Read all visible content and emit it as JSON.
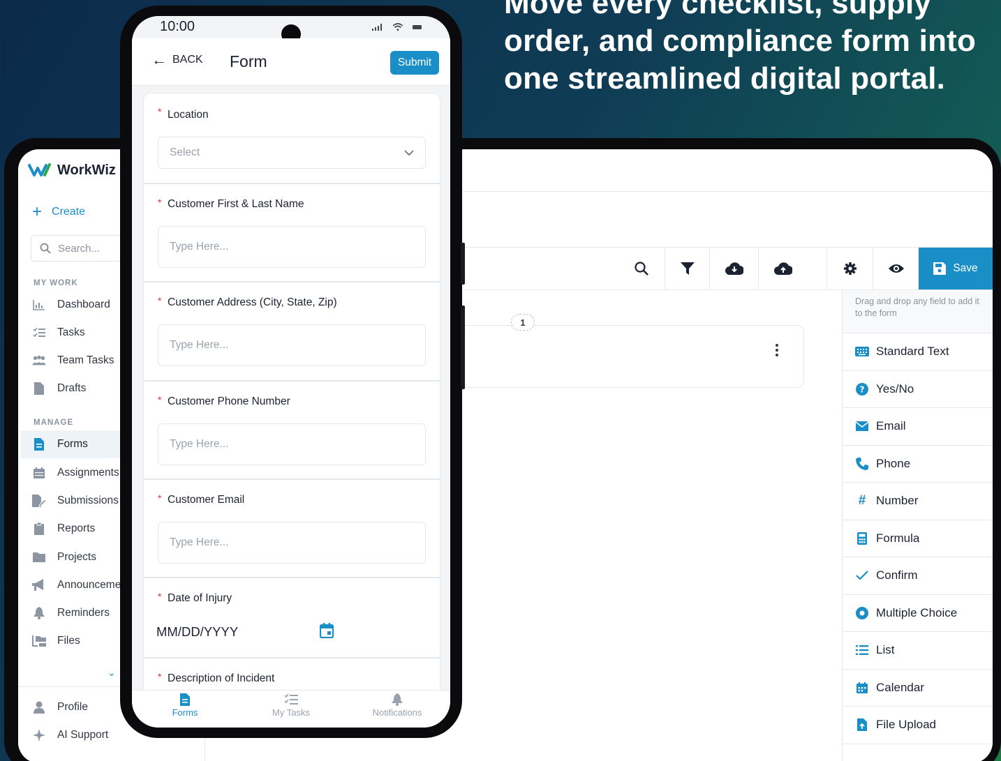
{
  "headline": "Move every checklist, supply order, and compliance form into one streamlined digital portal.",
  "tablet": {
    "logo_text": "WorkWiz",
    "create_label": "Create",
    "search_placeholder": "Search...",
    "sections": {
      "my_work": "MY WORK",
      "manage": "MANAGE"
    },
    "nav_my_work": [
      {
        "label": "Dashboard",
        "icon": "chart-icon"
      },
      {
        "label": "Tasks",
        "icon": "checklist-icon"
      },
      {
        "label": "Team Tasks",
        "icon": "team-icon"
      },
      {
        "label": "Drafts",
        "icon": "file-icon"
      }
    ],
    "nav_manage": [
      {
        "label": "Forms",
        "icon": "form-icon",
        "active": true
      },
      {
        "label": "Assignments",
        "icon": "calendar-icon"
      },
      {
        "label": "Submissions",
        "icon": "submission-icon"
      },
      {
        "label": "Reports",
        "icon": "clipboard-icon"
      },
      {
        "label": "Projects",
        "icon": "folder-icon"
      },
      {
        "label": "Announcements",
        "icon": "megaphone-icon"
      },
      {
        "label": "Reminders",
        "icon": "bell-icon"
      },
      {
        "label": "Files",
        "icon": "files-icon"
      }
    ],
    "nav_bottom": [
      {
        "label": "Profile",
        "icon": "user-icon"
      },
      {
        "label": "AI Support",
        "icon": "sparkle-icon"
      }
    ],
    "toolbar": {
      "save_label": "Save"
    },
    "canvas": {
      "page_badge": "1"
    },
    "fields_hint": "Drag and drop any field to add it to the form",
    "fields": [
      {
        "label": "Standard Text",
        "icon": "keyboard-icon"
      },
      {
        "label": "Yes/No",
        "icon": "question-icon"
      },
      {
        "label": "Email",
        "icon": "envelope-icon"
      },
      {
        "label": "Phone",
        "icon": "phone-icon"
      },
      {
        "label": "Number",
        "icon": "hash-icon"
      },
      {
        "label": "Formula",
        "icon": "calculator-icon"
      },
      {
        "label": "Confirm",
        "icon": "check-icon"
      },
      {
        "label": "Multiple Choice",
        "icon": "radio-icon"
      },
      {
        "label": "List",
        "icon": "list-icon"
      },
      {
        "label": "Calendar",
        "icon": "calendar-icon"
      },
      {
        "label": "File Upload",
        "icon": "upload-file-icon"
      }
    ]
  },
  "phone": {
    "time": "10:00",
    "back_label": "BACK",
    "title": "Form",
    "submit_label": "Submit",
    "fields": {
      "location": {
        "label": "Location",
        "placeholder": "Select"
      },
      "name": {
        "label": "Customer First & Last Name",
        "placeholder": "Type Here..."
      },
      "address": {
        "label": "Customer Address (City, State, Zip)",
        "placeholder": "Type Here..."
      },
      "phone": {
        "label": "Customer Phone Number",
        "placeholder": "Type Here..."
      },
      "email": {
        "label": "Customer Email",
        "placeholder": "Type Here..."
      },
      "date": {
        "label": "Date of Injury",
        "value": "MM/DD/YYYY"
      },
      "description": {
        "label": "Description of Incident"
      }
    },
    "bottom_nav": [
      {
        "label": "Forms",
        "active": true
      },
      {
        "label": "My Tasks"
      },
      {
        "label": "Notifications"
      }
    ]
  },
  "colors": {
    "accent": "#1a8fc7",
    "required": "#dd3333",
    "text": "#1b2230"
  }
}
